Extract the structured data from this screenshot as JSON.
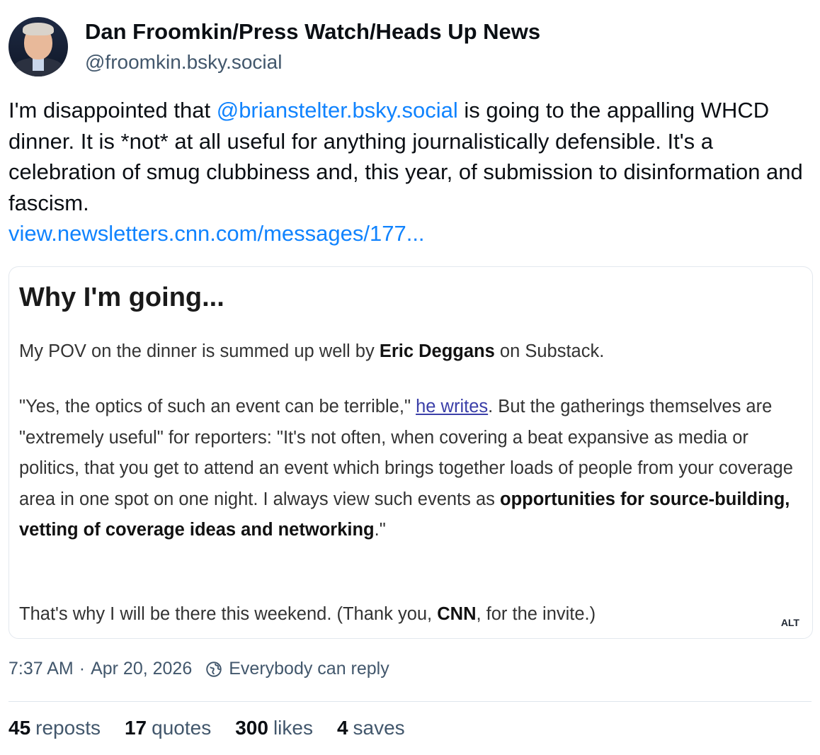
{
  "author": {
    "display_name": "Dan Froomkin/Press Watch/Heads Up News",
    "handle": "@froomkin.bsky.social"
  },
  "post": {
    "text_before_mention": "I'm disappointed that ",
    "mention": "@brianstelter.bsky.social",
    "text_after_mention": " is going to the appalling WHCD dinner. It is *not* at all useful for anything journalistically defensible. It's a celebration of smug clubbiness and, this year, of submission to disinformation and fascism.",
    "link": "view.newsletters.cnn.com/messages/177..."
  },
  "embed_image": {
    "heading": "Why I'm going...",
    "p1_before": "My POV on the dinner is summed up well by ",
    "p1_bold": "Eric Deggans",
    "p1_after": " on Substack.",
    "p2_before": "\"Yes, the optics of such an event can be terrible,\" ",
    "p2_link": "he writes",
    "p2_mid": ". But the gatherings themselves are \"extremely useful\" for reporters: \"It's not often, when covering a beat expansive as media or politics, that you get to attend an event which brings together loads of people from your coverage area in one spot on one night. I always view such events as ",
    "p2_bold": "opportunities for source-building, vetting of coverage ideas and networking",
    "p2_after": ".\"",
    "p3_before": "That's why I will be there this weekend. (Thank you, ",
    "p3_bold": "CNN",
    "p3_after": ", for the invite.)",
    "alt_label": "ALT"
  },
  "meta": {
    "time": "7:37 AM",
    "separator": "·",
    "date": "Apr 20, 2026",
    "reply_setting": "Everybody can reply",
    "reply_icon": "globe-icon"
  },
  "stats": [
    {
      "count": "45",
      "label": "reposts"
    },
    {
      "count": "17",
      "label": "quotes"
    },
    {
      "count": "300",
      "label": "likes"
    },
    {
      "count": "4",
      "label": "saves"
    }
  ],
  "colors": {
    "link": "#1083fe",
    "muted": "#42576c",
    "text": "#0b0f14"
  }
}
